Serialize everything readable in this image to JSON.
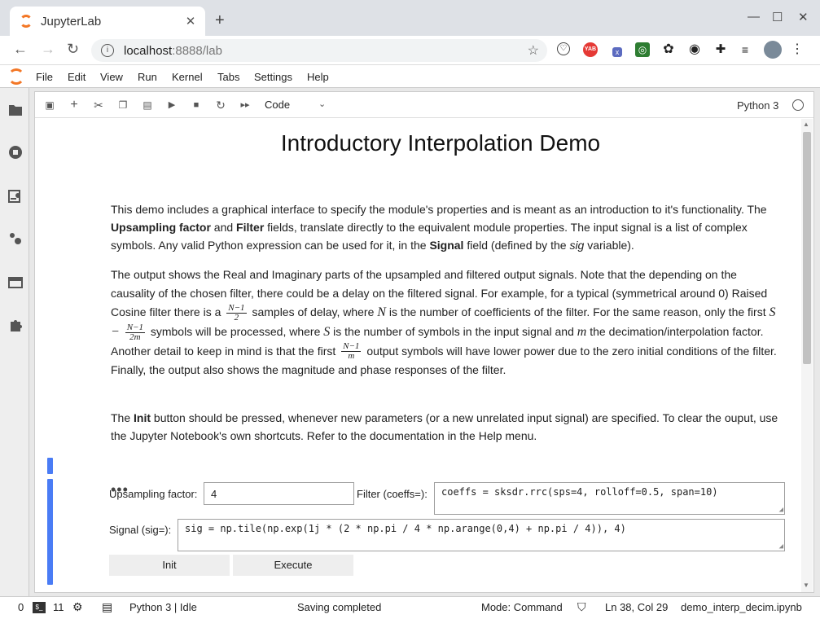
{
  "browser": {
    "tab_title": "JupyterLab",
    "url_host": "localhost",
    "url_path": ":8888/lab",
    "ext_yab": "YAB"
  },
  "menu": [
    "File",
    "Edit",
    "View",
    "Run",
    "Kernel",
    "Tabs",
    "Settings",
    "Help"
  ],
  "nb_toolbar": {
    "cell_type": "Code",
    "kernel": "Python 3"
  },
  "notebook": {
    "title": "Introductory Interpolation Demo",
    "p1": {
      "a": "This demo includes a graphical interface to specify the module's properties and is meant as an introduction to it's functionality. The ",
      "b1": "Upsampling factor",
      "c": " and ",
      "b2": "Filter",
      "d": " fields, translate directly to the equivalent module properties. The input signal is a list of complex symbols. Any valid Python expression can be used for it, in the ",
      "b3": "Signal",
      "e": " field (defined by the ",
      "i1": "sig",
      "f": " variable)."
    },
    "p2": {
      "a": "The output shows the Real and Imaginary parts of the upsampled and filtered output signals. Note that the depending on the causality of the chosen filter, there could be a delay on the filtered signal. For example, for a typical (symmetrical around 0) Raised Cosine filter there is a",
      "f1_num": "N−1",
      "f1_den": "2",
      "b": "samples of delay, where",
      "m1": "N",
      "c": "is the number of coefficients of the filter. For the same reason, only the first",
      "m2": "S −",
      "f2_num": "N−1",
      "f2_den": "2m",
      "d": "symbols will be processed, where",
      "m3": "S",
      "e": "is the number of symbols in the input signal and",
      "m4": "m",
      "f": "the decimation/interpolation factor. Another detail to keep in mind is that the first",
      "f3_num": "N−1",
      "f3_den": "m",
      "g": "output symbols will have lower power due to the zero initial conditions of the filter.",
      "h": "Finally, the output also shows the magnitude and phase responses of the filter."
    },
    "p3": {
      "a": "The ",
      "b": "Init",
      "c": " button should be pressed, whenever new parameters (or a new unrelated input signal) are specified. To clear the ouput, use the Jupyter Notebook's own shortcuts. Refer to the documentation in the Help menu."
    },
    "collapsed_output": "•••",
    "widgets": {
      "upsampling_label": "Upsampling factor:",
      "upsampling_value": "4",
      "filter_label": "Filter (coeffs=):",
      "filter_value": "coeffs = sksdr.rrc(sps=4, rolloff=0.5, span=10)",
      "signal_label": "Signal (sig=):",
      "signal_value": "sig = np.tile(np.exp(1j * (2 * np.pi / 4 * np.arange(0,4) + np.pi / 4)), 4)",
      "init_label": "Init",
      "execute_label": "Execute"
    }
  },
  "status": {
    "count_a": "0",
    "count_b": "11",
    "kernel_status": "Python 3 | Idle",
    "save_status": "Saving completed",
    "mode": "Mode: Command",
    "position": "Ln 38, Col 29",
    "filename": "demo_interp_decim.ipynb"
  },
  "colors": {
    "accent": "#f37726",
    "cell_active": "#4a7cf5"
  }
}
